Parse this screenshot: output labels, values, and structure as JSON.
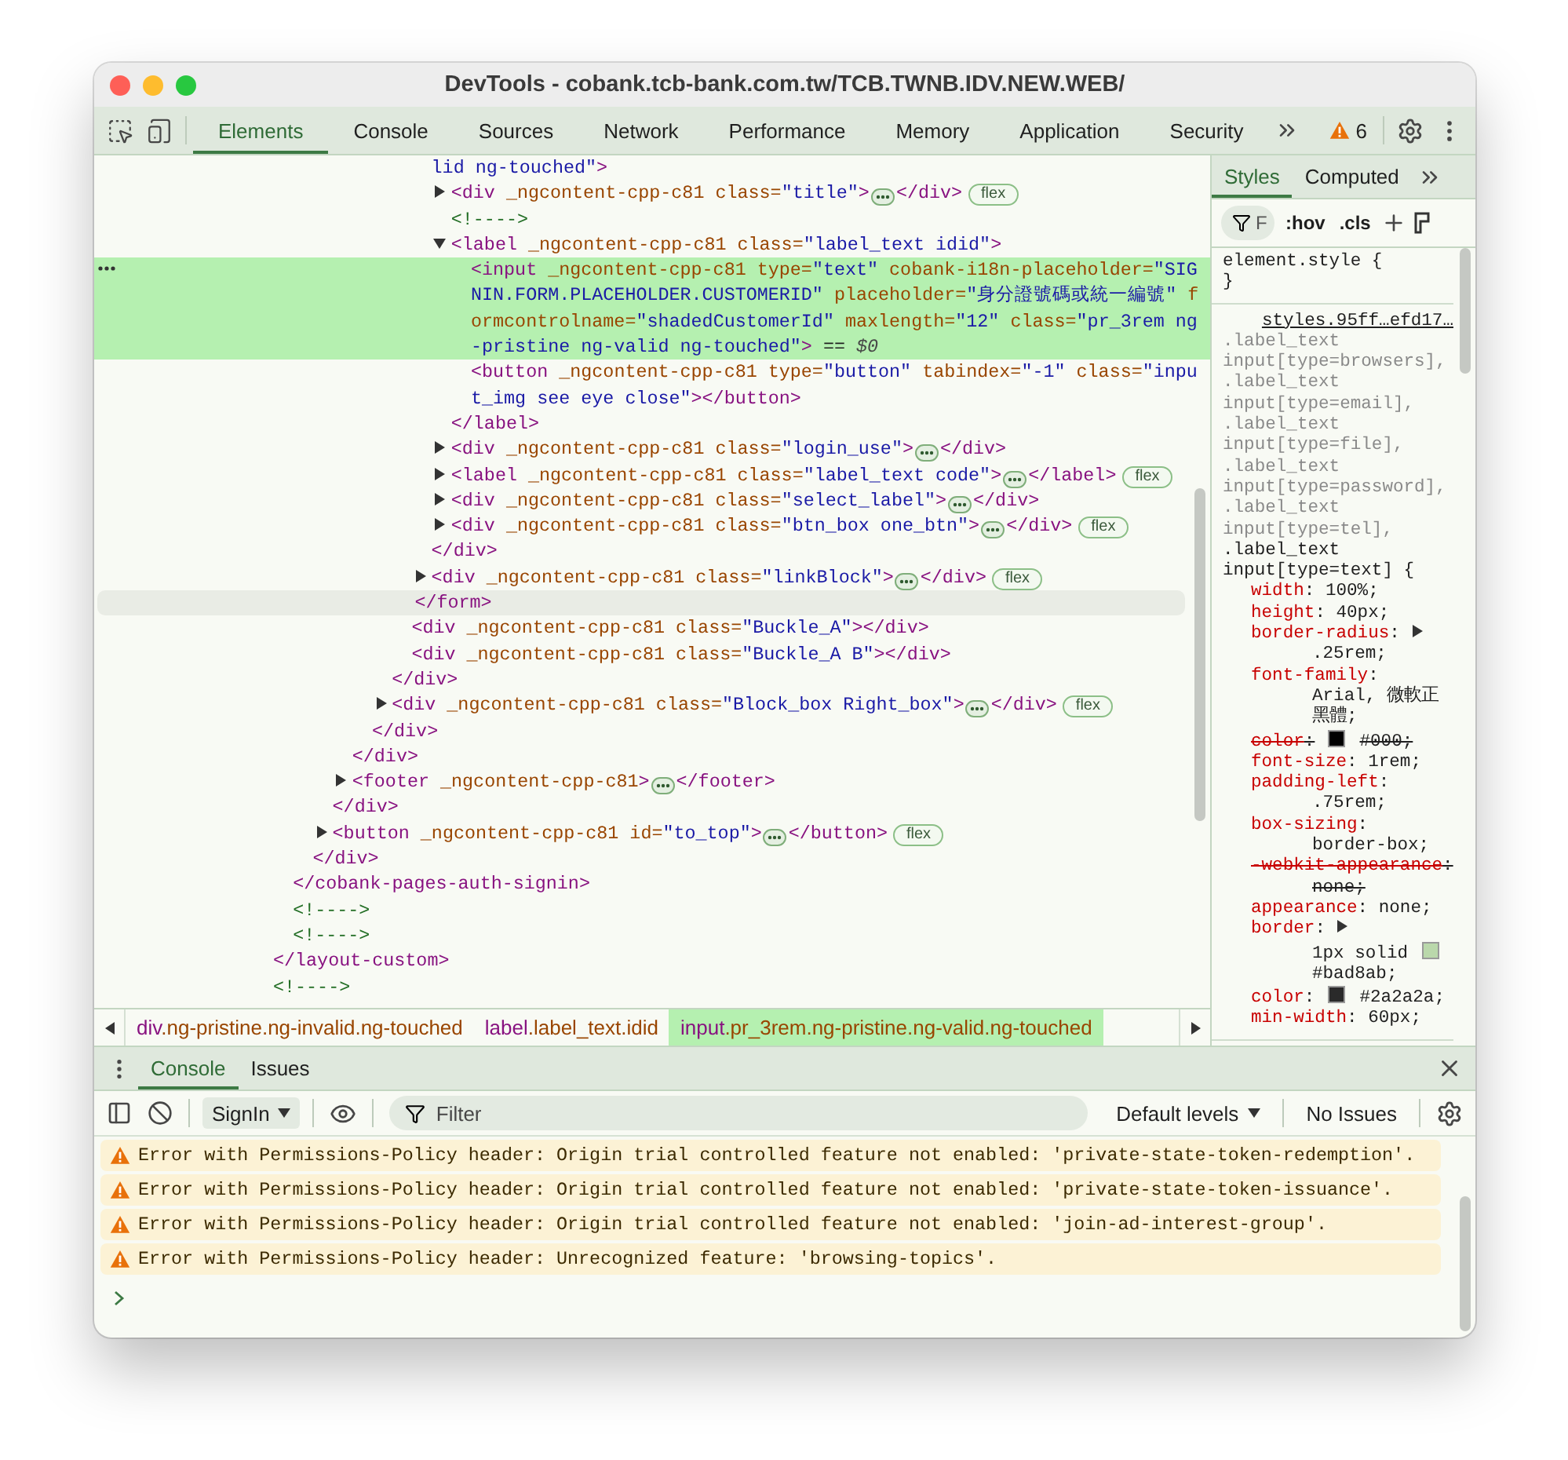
{
  "window": {
    "title": "DevTools - cobank.tcb-bank.com.tw/TCB.TWNB.IDV.NEW.WEB/"
  },
  "main_tabs": [
    {
      "label": "Elements",
      "selected": true
    },
    {
      "label": "Console",
      "selected": false
    },
    {
      "label": "Sources",
      "selected": false
    },
    {
      "label": "Network",
      "selected": false
    },
    {
      "label": "Performance",
      "selected": false
    },
    {
      "label": "Memory",
      "selected": false
    },
    {
      "label": "Application",
      "selected": false
    },
    {
      "label": "Security",
      "selected": false
    }
  ],
  "issues_count": "6",
  "dom_tree": [
    {
      "close": [
        {
          "kind": "tag",
          "text": "</layout-custom>"
        }
      ],
      "children": [
        {
          "close": [
            {
              "kind": "tag",
              "text": "</cobank-pages-auth-signin>"
            }
          ],
          "children": [
            {
              "close": [
                {
                  "kind": "tag",
                  "text": "</div>"
                }
              ],
              "children": [
                {
                  "close": [
                    {
                      "kind": "tag",
                      "text": "</div>"
                    }
                  ],
                  "children": [
                    {
                      "close": [
                        {
                          "kind": "tag",
                          "text": "</div>"
                        }
                      ],
                      "children": [
                        {
                          "close": [
                            {
                              "kind": "tag",
                              "text": "</div>"
                            }
                          ],
                          "children": [
                            {
                              "close": [
                                {
                                  "kind": "tag",
                                  "text": "</div>"
                                }
                              ],
                              "children": [
                                {
                                  "close": [
                                    {
                                      "kind": "tag",
                                      "text": "</form>"
                                    }
                                  ],
                                  "hovered": true,
                                  "children": [
                                    {
                                      "open": [
                                        {
                                          "kind": "value",
                                          "text": "lid ng-touched\""
                                        },
                                        {
                                          "kind": "tag",
                                          "text": ">"
                                        }
                                      ],
                                      "close": [
                                        {
                                          "kind": "tag",
                                          "text": "</div>"
                                        }
                                      ],
                                      "children": [
                                        {
                                          "expanded": false,
                                          "badge": "flex",
                                          "open": [
                                            {
                                              "kind": "tag",
                                              "text": "<div"
                                            },
                                            {
                                              "kind": "attr",
                                              "text": " _ngcontent-cpp-c81 class="
                                            },
                                            {
                                              "kind": "value",
                                              "text": "\"title\""
                                            },
                                            {
                                              "kind": "tag",
                                              "text": ">"
                                            },
                                            {
                                              "kind": "more"
                                            },
                                            {
                                              "kind": "tag",
                                              "text": "</div>"
                                            }
                                          ]
                                        },
                                        {
                                          "open": [
                                            {
                                              "kind": "comment",
                                              "text": "<!---->"
                                            }
                                          ]
                                        },
                                        {
                                          "expanded": true,
                                          "open": [
                                            {
                                              "kind": "tag",
                                              "text": "<label"
                                            },
                                            {
                                              "kind": "attr",
                                              "text": " _ngcontent-cpp-c81 class="
                                            },
                                            {
                                              "kind": "value",
                                              "text": "\"label_text idid\""
                                            },
                                            {
                                              "kind": "tag",
                                              "text": ">"
                                            }
                                          ],
                                          "close": [
                                            {
                                              "kind": "tag",
                                              "text": "</label>"
                                            }
                                          ],
                                          "children": [
                                            {
                                              "selected": true,
                                              "open": [
                                                {
                                                  "kind": "tag",
                                                  "text": "<input"
                                                },
                                                {
                                                  "kind": "attr",
                                                  "text": " _ngcontent-cpp-c81 type="
                                                },
                                                {
                                                  "kind": "value",
                                                  "text": "\"text\""
                                                },
                                                {
                                                  "kind": "attr",
                                                  "text": " cobank-i18n-placeholder="
                                                },
                                                {
                                                  "kind": "value",
                                                  "text": "\"SIGNIN.FORM.PLACEHOLDER.CUSTOMERID\""
                                                },
                                                {
                                                  "kind": "attr",
                                                  "text": " placeholder="
                                                },
                                                {
                                                  "kind": "value",
                                                  "text": "\"身分證號碼或統一編號\""
                                                },
                                                {
                                                  "kind": "attr",
                                                  "text": " formcontrolname="
                                                },
                                                {
                                                  "kind": "value",
                                                  "text": "\"shadedCustomerId\""
                                                },
                                                {
                                                  "kind": "attr",
                                                  "text": " maxlength="
                                                },
                                                {
                                                  "kind": "value",
                                                  "text": "\"12\""
                                                },
                                                {
                                                  "kind": "attr",
                                                  "text": " class="
                                                },
                                                {
                                                  "kind": "value",
                                                  "text": "\"pr_3rem ng-pristine ng-valid ng-touched\""
                                                },
                                                {
                                                  "kind": "tag",
                                                  "text": ">"
                                                },
                                                {
                                                  "kind": "plain",
                                                  "text": " == "
                                                },
                                                {
                                                  "kind": "ref",
                                                  "text": "$0"
                                                }
                                              ]
                                            },
                                            {
                                              "selected": false,
                                              "open": [
                                                {
                                                  "kind": "tag",
                                                  "text": "<button"
                                                },
                                                {
                                                  "kind": "attr",
                                                  "text": " _ngcontent-cpp-c81 type="
                                                },
                                                {
                                                  "kind": "value",
                                                  "text": "\"button\""
                                                },
                                                {
                                                  "kind": "attr",
                                                  "text": " tabindex="
                                                },
                                                {
                                                  "kind": "value",
                                                  "text": "\"-1\""
                                                },
                                                {
                                                  "kind": "attr",
                                                  "text": " class="
                                                },
                                                {
                                                  "kind": "value",
                                                  "text": "\"input_img see eye close\""
                                                },
                                                {
                                                  "kind": "tag",
                                                  "text": "></button>"
                                                }
                                              ]
                                            }
                                          ]
                                        },
                                        {
                                          "expanded": false,
                                          "open": [
                                            {
                                              "kind": "tag",
                                              "text": "<div"
                                            },
                                            {
                                              "kind": "attr",
                                              "text": " _ngcontent-cpp-c81 class="
                                            },
                                            {
                                              "kind": "value",
                                              "text": "\"login_use\""
                                            },
                                            {
                                              "kind": "tag",
                                              "text": ">"
                                            },
                                            {
                                              "kind": "more"
                                            },
                                            {
                                              "kind": "tag",
                                              "text": "</div>"
                                            }
                                          ]
                                        },
                                        {
                                          "expanded": false,
                                          "badge": "flex",
                                          "open": [
                                            {
                                              "kind": "tag",
                                              "text": "<label"
                                            },
                                            {
                                              "kind": "attr",
                                              "text": " _ngcontent-cpp-c81 class="
                                            },
                                            {
                                              "kind": "value",
                                              "text": "\"label_text code\""
                                            },
                                            {
                                              "kind": "tag",
                                              "text": ">"
                                            },
                                            {
                                              "kind": "more"
                                            },
                                            {
                                              "kind": "tag",
                                              "text": "</label>"
                                            }
                                          ]
                                        },
                                        {
                                          "expanded": false,
                                          "open": [
                                            {
                                              "kind": "tag",
                                              "text": "<div"
                                            },
                                            {
                                              "kind": "attr",
                                              "text": " _ngcontent-cpp-c81 class="
                                            },
                                            {
                                              "kind": "value",
                                              "text": "\"select_label\""
                                            },
                                            {
                                              "kind": "tag",
                                              "text": ">"
                                            },
                                            {
                                              "kind": "more"
                                            },
                                            {
                                              "kind": "tag",
                                              "text": "</div>"
                                            }
                                          ]
                                        },
                                        {
                                          "expanded": false,
                                          "badge": "flex",
                                          "open": [
                                            {
                                              "kind": "tag",
                                              "text": "<div"
                                            },
                                            {
                                              "kind": "attr",
                                              "text": " _ngcontent-cpp-c81 class="
                                            },
                                            {
                                              "kind": "value",
                                              "text": "\"btn_box one_btn\""
                                            },
                                            {
                                              "kind": "tag",
                                              "text": ">"
                                            },
                                            {
                                              "kind": "more"
                                            },
                                            {
                                              "kind": "tag",
                                              "text": "</div>"
                                            }
                                          ]
                                        }
                                      ]
                                    },
                                    {
                                      "expanded": false,
                                      "badge": "flex",
                                      "open": [
                                        {
                                          "kind": "tag",
                                          "text": "<div"
                                        },
                                        {
                                          "kind": "attr",
                                          "text": " _ngcontent-cpp-c81 class="
                                        },
                                        {
                                          "kind": "value",
                                          "text": "\"linkBlock\""
                                        },
                                        {
                                          "kind": "tag",
                                          "text": ">"
                                        },
                                        {
                                          "kind": "more"
                                        },
                                        {
                                          "kind": "tag",
                                          "text": "</div>"
                                        }
                                      ]
                                    }
                                  ]
                                },
                                {
                                  "open": [
                                    {
                                      "kind": "tag",
                                      "text": "<div"
                                    },
                                    {
                                      "kind": "attr",
                                      "text": " _ngcontent-cpp-c81 class="
                                    },
                                    {
                                      "kind": "value",
                                      "text": "\"Buckle_A\""
                                    },
                                    {
                                      "kind": "tag",
                                      "text": "></div>"
                                    }
                                  ]
                                },
                                {
                                  "open": [
                                    {
                                      "kind": "tag",
                                      "text": "<div"
                                    },
                                    {
                                      "kind": "attr",
                                      "text": " _ngcontent-cpp-c81 class="
                                    },
                                    {
                                      "kind": "value",
                                      "text": "\"Buckle_A B\""
                                    },
                                    {
                                      "kind": "tag",
                                      "text": "></div>"
                                    }
                                  ]
                                }
                              ]
                            },
                            {
                              "expanded": false,
                              "badge": "flex",
                              "open": [
                                {
                                  "kind": "tag",
                                  "text": "<div"
                                },
                                {
                                  "kind": "attr",
                                  "text": " _ngcontent-cpp-c81 class="
                                },
                                {
                                  "kind": "value",
                                  "text": "\"Block_box Right_box\""
                                },
                                {
                                  "kind": "tag",
                                  "text": ">"
                                },
                                {
                                  "kind": "more"
                                },
                                {
                                  "kind": "tag",
                                  "text": "</div>"
                                }
                              ]
                            }
                          ]
                        }
                      ]
                    },
                    {
                      "expanded": false,
                      "open": [
                        {
                          "kind": "tag",
                          "text": "<footer"
                        },
                        {
                          "kind": "attr",
                          "text": " _ngcontent-cpp-c81"
                        },
                        {
                          "kind": "tag",
                          "text": ">"
                        },
                        {
                          "kind": "more"
                        },
                        {
                          "kind": "tag",
                          "text": "</footer>"
                        }
                      ]
                    }
                  ]
                },
                {
                  "expanded": false,
                  "badge": "flex",
                  "open": [
                    {
                      "kind": "tag",
                      "text": "<button"
                    },
                    {
                      "kind": "attr",
                      "text": " _ngcontent-cpp-c81 id="
                    },
                    {
                      "kind": "value",
                      "text": "\"to_top\""
                    },
                    {
                      "kind": "tag",
                      "text": ">"
                    },
                    {
                      "kind": "more"
                    },
                    {
                      "kind": "tag",
                      "text": "</button>"
                    }
                  ]
                }
              ]
            }
          ]
        },
        {
          "open": [
            {
              "kind": "comment",
              "text": "<!---->"
            }
          ]
        },
        {
          "open": [
            {
              "kind": "comment",
              "text": "<!---->"
            }
          ]
        }
      ]
    },
    {
      "open": [
        {
          "kind": "comment",
          "text": "<!---->"
        }
      ]
    }
  ],
  "breadcrumbs": [
    {
      "tag": "div",
      "classes": ".ng-pristine.ng-invalid.ng-touched",
      "selected": false
    },
    {
      "tag": "label",
      "classes": ".label_text.idid",
      "selected": false
    },
    {
      "tag": "input",
      "classes": ".pr_3rem.ng-pristine.ng-valid.ng-touched",
      "selected": true
    }
  ],
  "styles_panel": {
    "tabs": [
      {
        "label": "Styles",
        "selected": true
      },
      {
        "label": "Computed",
        "selected": false
      }
    ],
    "filter": {
      "placeholder": "F"
    },
    "hov": ":hov",
    "cls": ".cls",
    "rules": [
      {
        "selectors": [
          {
            "text": "element.style",
            "matched": true
          }
        ],
        "open": "{",
        "close": "}"
      },
      {
        "source": "styles.95ff…efd17…",
        "selectors": [
          {
            "text": ".label_text input[type=browsers],",
            "matched": false
          },
          {
            "text": ".label_text input[type=email],",
            "matched": false
          },
          {
            "text": ".label_text input[type=file],",
            "matched": false
          },
          {
            "text": ".label_text input[type=password],",
            "matched": false
          },
          {
            "text": ".label_text input[type=tel],",
            "matched": false
          },
          {
            "text": ".label_text input[type=text]",
            "matched": true
          }
        ],
        "open": "{",
        "properties": [
          {
            "name": "width",
            "struck": false,
            "value": [
              {
                "kind": "text",
                "text": ":"
              },
              {
                "kind": "text",
                "text": "100%;"
              }
            ]
          },
          {
            "name": "height",
            "struck": false,
            "value": [
              {
                "kind": "text",
                "text": ":"
              },
              {
                "kind": "text",
                "text": "40px;"
              }
            ]
          },
          {
            "name": "border-radius",
            "struck": false,
            "value": [
              {
                "kind": "text",
                "text": ":"
              },
              {
                "kind": "expander"
              },
              {
                "kind": "text",
                "text": ".25rem;"
              }
            ]
          },
          {
            "name": "font-family",
            "struck": false,
            "value": [
              {
                "kind": "text",
                "text": ":"
              },
              {
                "kind": "text",
                "text": "Arial, 微軟正黑體;"
              }
            ]
          },
          {
            "name": "color",
            "struck": true,
            "value": [
              {
                "kind": "text",
                "text": ":"
              },
              {
                "kind": "swatch",
                "color": "#000000"
              },
              {
                "kind": "text",
                "text": "#000;"
              }
            ]
          },
          {
            "name": "font-size",
            "struck": false,
            "value": [
              {
                "kind": "text",
                "text": ":"
              },
              {
                "kind": "text",
                "text": "1rem;"
              }
            ]
          },
          {
            "name": "padding-left",
            "struck": false,
            "value": [
              {
                "kind": "text",
                "text": ":"
              },
              {
                "kind": "text",
                "text": ".75rem;"
              }
            ]
          },
          {
            "name": "box-sizing",
            "struck": false,
            "value": [
              {
                "kind": "text",
                "text": ":"
              },
              {
                "kind": "text",
                "text": "border-box;"
              }
            ]
          },
          {
            "name": "-webkit-appearance",
            "struck": true,
            "value": [
              {
                "kind": "text",
                "text": ":"
              },
              {
                "kind": "text",
                "text": "none;"
              }
            ]
          },
          {
            "name": "appearance",
            "struck": false,
            "value": [
              {
                "kind": "text",
                "text": ":"
              },
              {
                "kind": "text",
                "text": "none;"
              }
            ]
          },
          {
            "name": "border",
            "struck": false,
            "value": [
              {
                "kind": "text",
                "text": ":"
              },
              {
                "kind": "expander"
              },
              {
                "kind": "text",
                "text": "1px solid"
              },
              {
                "kind": "swatch",
                "color": "#bad8ab"
              },
              {
                "kind": "text",
                "text": "#bad8ab;"
              }
            ]
          },
          {
            "name": "color",
            "struck": false,
            "value": [
              {
                "kind": "text",
                "text": ":"
              },
              {
                "kind": "swatch",
                "color": "#2a2a2a"
              },
              {
                "kind": "text",
                "text": "#2a2a2a;"
              }
            ]
          },
          {
            "name": "min-width",
            "struck": false,
            "value": [
              {
                "kind": "text",
                "text": ":"
              },
              {
                "kind": "text",
                "text": "60px;"
              }
            ]
          }
        ]
      }
    ]
  },
  "drawer": {
    "tabs": [
      {
        "label": "Console",
        "selected": true
      },
      {
        "label": "Issues",
        "selected": false
      }
    ],
    "context": "SignIn",
    "filter": {
      "placeholder": "Filter"
    },
    "levels": "Default levels",
    "issues": "No Issues",
    "messages": [
      {
        "kind": "warning",
        "text": "Error with Permissions-Policy header: Origin trial controlled feature not enabled: 'private-state-token-redemption'."
      },
      {
        "kind": "warning",
        "text": "Error with Permissions-Policy header: Origin trial controlled feature not enabled: 'private-state-token-issuance'."
      },
      {
        "kind": "warning",
        "text": "Error with Permissions-Policy header: Origin trial controlled feature not enabled: 'join-ad-interest-group'."
      },
      {
        "kind": "warning",
        "text": "Error with Permissions-Policy header: Unrecognized feature: 'browsing-topics'."
      }
    ]
  }
}
